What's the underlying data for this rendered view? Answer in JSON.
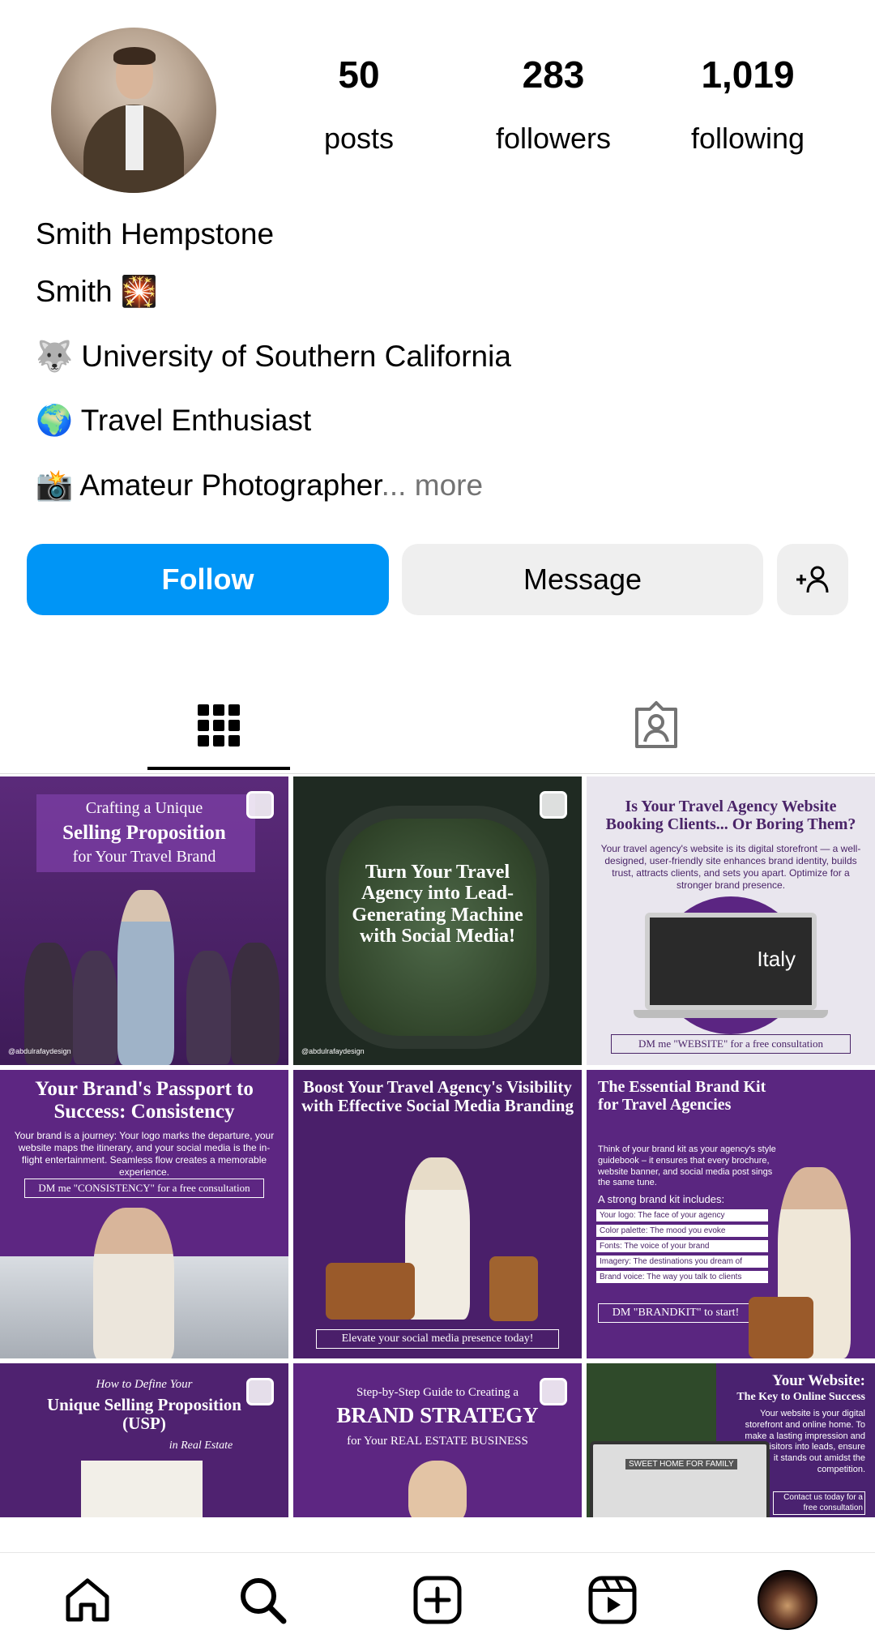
{
  "profile": {
    "stats": [
      {
        "value": "50",
        "label": "posts"
      },
      {
        "value": "283",
        "label": "followers"
      },
      {
        "value": "1,019",
        "label": "following"
      }
    ],
    "name": "Smith Hempstone",
    "bio": [
      {
        "emoji": "",
        "text": "Smith 🎇"
      },
      {
        "emoji": "🐺",
        "text": "University of Southern California"
      },
      {
        "emoji": "🌍",
        "text": "Travel Enthusiast"
      },
      {
        "emoji": "📸",
        "text": "Amateur Photographer",
        "more": "... more"
      }
    ]
  },
  "actions": {
    "follow": "Follow",
    "message": "Message"
  },
  "posts": [
    {
      "t1": "Crafting a Unique",
      "t2": "Selling Proposition",
      "t3": "for Your Travel Brand",
      "handle": "@abdulrafaydesign"
    },
    {
      "t1": "Turn Your Travel Agency into Lead-Generating Machine with Social Media!",
      "handle": "@abdulrafaydesign"
    },
    {
      "t1": "Is Your Travel Agency Website Booking Clients... Or Boring Them?",
      "body": "Your travel agency's website is its digital storefront — a well-designed, user-friendly site enhances brand identity, builds trust, attracts clients, and sets you apart. Optimize for a stronger brand presence.",
      "screen": "Italy",
      "cta": "DM me \"WEBSITE\" for a free consultation"
    },
    {
      "t1": "Your Brand's Passport to Success: Consistency",
      "body": "Your brand is a journey: Your logo marks the departure, your website maps the itinerary, and your social media is the in-flight entertainment. Seamless flow creates a memorable experience.",
      "cta": "DM me \"CONSISTENCY\" for a free consultation"
    },
    {
      "t1": "Boost Your Travel Agency's Visibility with Effective Social Media Branding",
      "cta": "Elevate your social media presence today!"
    },
    {
      "t1": "The Essential Brand Kit for Travel Agencies",
      "body": "Think of your brand kit as your agency's style guidebook – it ensures that every brochure, website banner, and social media post sings the same tune.",
      "list_title": "A strong brand kit includes:",
      "list": [
        "Your logo: The face of your agency",
        "Color palette: The mood you evoke",
        "Fonts: The voice of your brand",
        "Imagery: The destinations you dream of",
        "Brand voice: The way you talk to clients"
      ],
      "cta": "DM \"BRANDKIT\" to start!"
    },
    {
      "t1": "How to Define Your",
      "t2": "Unique Selling Proposition (USP)",
      "t3": "in Real Estate"
    },
    {
      "t1": "Step-by-Step Guide to Creating a",
      "t2": "BRAND STRATEGY",
      "t3": "for Your REAL ESTATE BUSINESS"
    },
    {
      "t1": "Your Website:",
      "t2": "The Key to Online Success",
      "body": "Your website is your digital storefront and online home. To make a lasting impression and convert visitors into leads, ensure it stands out amidst the competition.",
      "cta": "Contact us today for a free consultation",
      "screen": "SWEET HOME FOR FAMILY"
    }
  ]
}
